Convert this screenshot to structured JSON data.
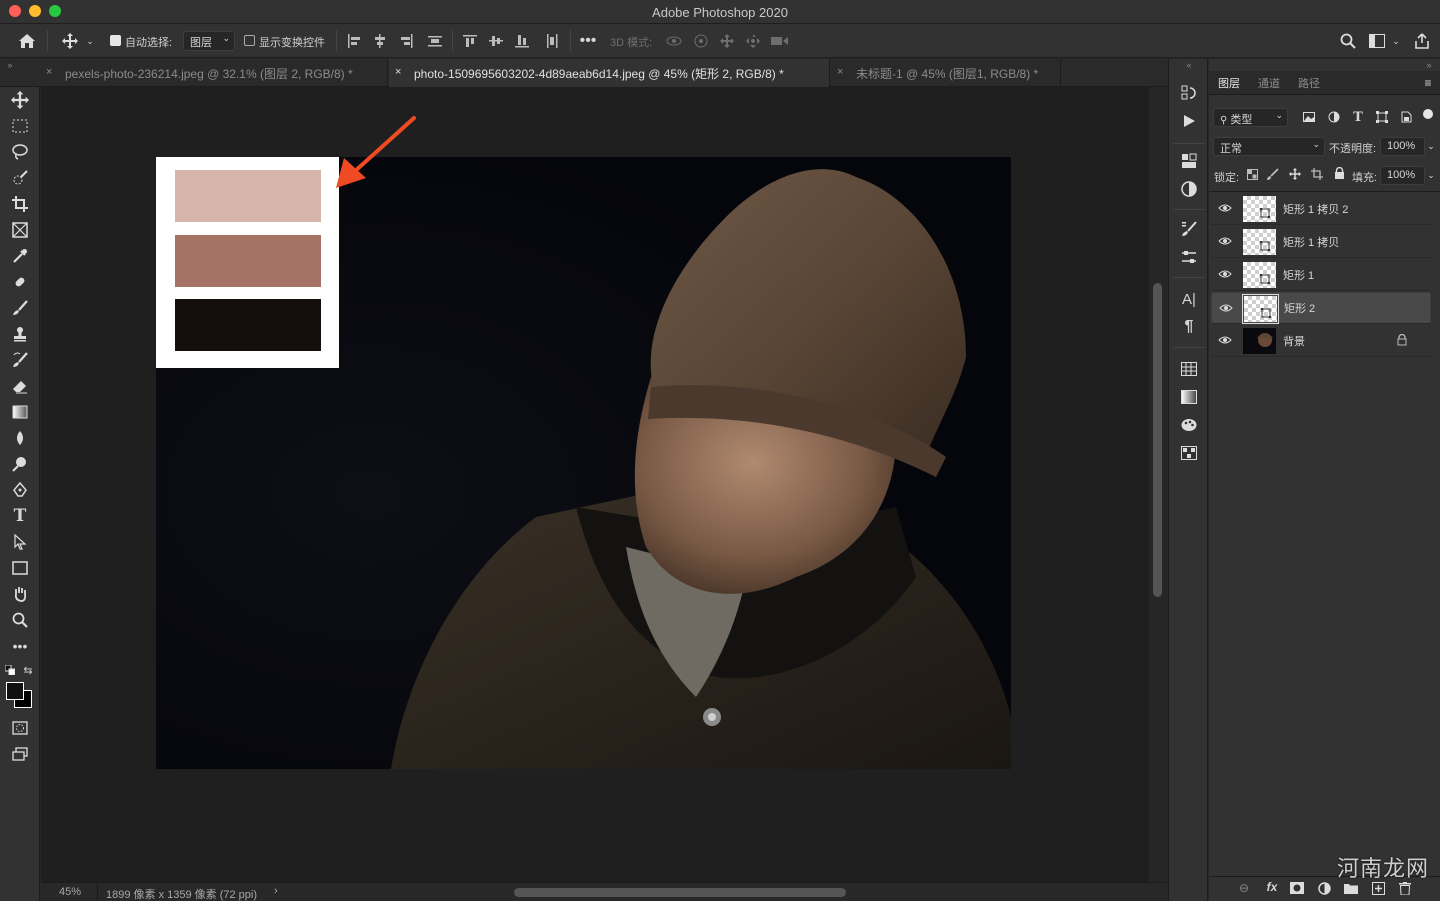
{
  "app": {
    "title": "Adobe Photoshop 2020"
  },
  "options": {
    "auto_select_label": "自动选择:",
    "auto_select_target": "图层",
    "show_transform_label": "显示变换控件",
    "three_d_mode_label": "3D 模式:"
  },
  "tabs": [
    {
      "label": "pexels-photo-236214.jpeg @ 32.1% (图层 2, RGB/8) *",
      "active": false
    },
    {
      "label": "photo-1509695603202-4d89aeab6d14.jpeg @ 45% (矩形 2, RGB/8) *",
      "active": true
    },
    {
      "label": "未标题-1 @ 45% (图层1, RGB/8) *",
      "active": false
    }
  ],
  "palette": {
    "swatches": [
      "#d8b5ac",
      "#a57366",
      "#140e0c"
    ]
  },
  "status": {
    "zoom": "45%",
    "doc_info": "1899 像素 x 1359 像素 (72 ppi)",
    "arrow": "›"
  },
  "layers_panel": {
    "tabs": [
      "图层",
      "通道",
      "路径"
    ],
    "filter_label": "类型",
    "blend_mode": "正常",
    "opacity_label": "不透明度:",
    "opacity_value": "100%",
    "lock_label": "锁定:",
    "fill_label": "填充:",
    "fill_value": "100%",
    "layers": [
      {
        "name": "矩形 1 拷贝 2",
        "selected": false
      },
      {
        "name": "矩形 1 拷贝",
        "selected": false
      },
      {
        "name": "矩形 1",
        "selected": false
      },
      {
        "name": "矩形 2",
        "selected": true
      },
      {
        "name": "背景",
        "selected": false
      }
    ]
  },
  "watermark": "河南龙网",
  "colors": {
    "accent_arrow": "#ef4a23",
    "panel_bg": "#323232",
    "canvas_bg": "#1f1f1f"
  }
}
